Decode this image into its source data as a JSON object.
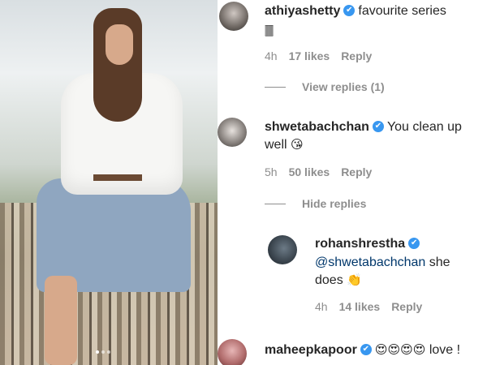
{
  "colors": {
    "verified": "#3897f0",
    "meta_text": "#8e8e8e",
    "mention": "#00376b"
  },
  "comments": [
    {
      "username": "athiyashetty",
      "verified": true,
      "text": "favourite series",
      "emoji_trailing": "🀫",
      "time": "4h",
      "likes": "17 likes",
      "reply": "Reply",
      "thread_label": "View replies (1)"
    },
    {
      "username": "shwetabachchan",
      "verified": true,
      "text_line1": "You clean up",
      "text_line2": "well",
      "emoji": "😘",
      "time": "5h",
      "likes": "50 likes",
      "reply": "Reply",
      "thread_label": "Hide replies"
    }
  ],
  "reply": {
    "username": "rohanshrestha",
    "verified": true,
    "mention": "@shwetabachchan",
    "text_tail": "she",
    "text_line2": "does",
    "emoji": "👏",
    "time": "4h",
    "likes": "14 likes",
    "reply": "Reply"
  },
  "last_comment": {
    "username": "maheepkapoor",
    "verified": true,
    "emoji": "😍😍😍😍",
    "text": "love !"
  },
  "verified_glyph": "✔"
}
